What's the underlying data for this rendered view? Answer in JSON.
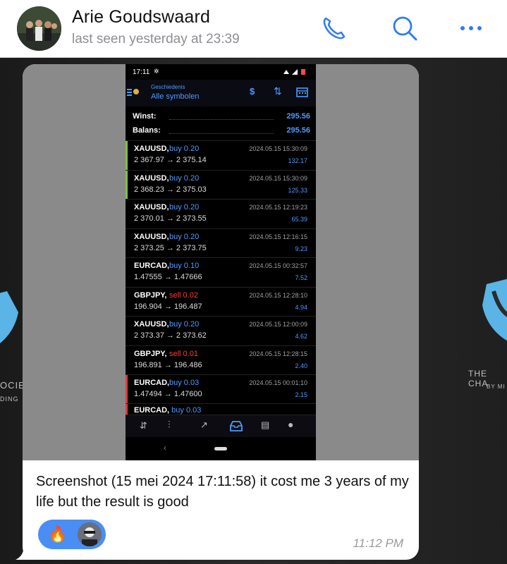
{
  "header": {
    "contact_name": "Arie Goudswaard",
    "last_seen": "last seen yesterday at 23:39",
    "icons": [
      "avatar",
      "phone-icon",
      "search-icon",
      "more-icon"
    ],
    "accent": "#2f7bf5"
  },
  "message": {
    "caption": "Screenshot (15 mei 2024 17:11:58) it cost me 3 years of my life but the result is good",
    "time": "11:12 PM",
    "reactions": [
      {
        "emoji": "🔥"
      },
      {
        "type": "avatar"
      }
    ]
  },
  "wallpaper": {
    "left_text1": "OCIE",
    "left_text2": "DING",
    "right_text1": "THE CHA",
    "right_text2": "BY MI"
  },
  "phone_screenshot": {
    "status_time": "17:11",
    "toolbar": {
      "subtitle": "Geschiedenis",
      "title": "Alle symbolen"
    },
    "winst_label": "Winst:",
    "winst_value": "295.56",
    "balans_label": "Balans:",
    "balans_value": "295.56",
    "trades": [
      {
        "symbol": "XAUUSD,",
        "action": "buy 0.20",
        "side": "buy",
        "prices": "2 367.97 → 2 375.14",
        "datetime": "2024.05.15 15:30:09",
        "profit": "132.17",
        "bar": "#7cc243"
      },
      {
        "symbol": "XAUUSD,",
        "action": "buy 0.20",
        "side": "buy",
        "prices": "2 368.23 → 2 375.03",
        "datetime": "2024.05.15 15:30:09",
        "profit": "125.33",
        "bar": "#7cc243"
      },
      {
        "symbol": "XAUUSD,",
        "action": "buy 0.20",
        "side": "buy",
        "prices": "2 370.01 → 2 373.55",
        "datetime": "2024.05.15 12:19:23",
        "profit": "65.39",
        "bar": ""
      },
      {
        "symbol": "XAUUSD,",
        "action": "buy 0.20",
        "side": "buy",
        "prices": "2 373.25 → 2 373.75",
        "datetime": "2024.05.15 12:16:15",
        "profit": "9.23",
        "bar": ""
      },
      {
        "symbol": "EURCAD,",
        "action": "buy 0.10",
        "side": "buy",
        "prices": "1.47555 → 1.47666",
        "datetime": "2024.05.15 00:32:57",
        "profit": "7.52",
        "bar": ""
      },
      {
        "symbol": "GBPJPY,",
        "action": "sell 0.02",
        "side": "sell",
        "prices": "196.904 → 196.487",
        "datetime": "2024.05.15 12:28:10",
        "profit": "4.94",
        "bar": ""
      },
      {
        "symbol": "XAUUSD,",
        "action": "buy 0.20",
        "side": "buy",
        "prices": "2 373.37 → 2 373.62",
        "datetime": "2024.05.15 12:00:09",
        "profit": "4.62",
        "bar": ""
      },
      {
        "symbol": "GBPJPY,",
        "action": "sell 0.01",
        "side": "sell",
        "prices": "196.891 → 196.486",
        "datetime": "2024.05.15 12:28:15",
        "profit": "2.40",
        "bar": ""
      },
      {
        "symbol": "EURCAD,",
        "action": "buy 0.03",
        "side": "buy",
        "prices": "1.47494 → 1.47600",
        "datetime": "2024.05.15 00:01:10",
        "profit": "2.15",
        "bar": "#e23a3a"
      }
    ],
    "buy_color": "#4a9cff",
    "sell_color": "#ff3b30",
    "bottom_nav": [
      "quotes-icon",
      "chart-icon",
      "trade-icon",
      "history-icon",
      "news-icon",
      "chat-icon"
    ]
  }
}
